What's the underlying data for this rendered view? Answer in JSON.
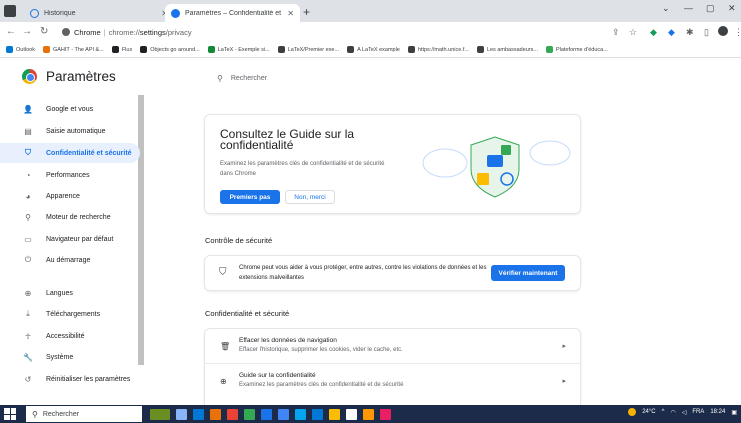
{
  "tabs": [
    {
      "title": "Historique",
      "close": "✕",
      "fav_color": "#1a73e8"
    },
    {
      "title": "Paramètres – Confidentialité et s",
      "close": "✕",
      "fav_color": "#1a73e8"
    }
  ],
  "window_controls": {
    "minimize": "—",
    "restore": "▢",
    "close": "✕",
    "chevron": "⌄"
  },
  "omnibox": {
    "origin": "Chrome",
    "path_prefix": "chrome://",
    "path_bold": "settings",
    "path_rest": "/privacy"
  },
  "bookmarks": [
    {
      "label": "Outlook",
      "color": "#0078d4"
    },
    {
      "label": "GAHIT - The API &...",
      "color": "#e8710a"
    },
    {
      "label": "Flux",
      "color": "#202124"
    },
    {
      "label": "Objects go around...",
      "color": "#202124"
    },
    {
      "label": "LaTeX - Exemple si...",
      "color": "#138a36"
    },
    {
      "label": "LaTeX/Premier exe...",
      "color": "#3c4043"
    },
    {
      "label": "A LaTeX example",
      "color": "#3c4043"
    },
    {
      "label": "https://math.unice.f...",
      "color": "#3c4043"
    },
    {
      "label": "Les ambassadeurs...",
      "color": "#3c4043"
    },
    {
      "label": "Plateforme d'éduca...",
      "color": "#34a853"
    }
  ],
  "settings": {
    "title": "Paramètres",
    "search_placeholder": "Rechercher"
  },
  "sidebar": {
    "items": [
      {
        "label": "Google et vous",
        "icon": "person-icon",
        "glyph": "👤",
        "active": false
      },
      {
        "label": "Saisie automatique",
        "icon": "clipboard-icon",
        "glyph": "▤",
        "active": false
      },
      {
        "label": "Confidentialité et sécurité",
        "icon": "shield-icon",
        "glyph": "⛉",
        "active": true
      },
      {
        "label": "Performances",
        "icon": "gauge-icon",
        "glyph": "◔",
        "active": false
      },
      {
        "label": "Apparence",
        "icon": "palette-icon",
        "glyph": "◕",
        "active": false
      },
      {
        "label": "Moteur de recherche",
        "icon": "search-icon",
        "glyph": "⚲",
        "active": false
      },
      {
        "label": "Navigateur par défaut",
        "icon": "browser-icon",
        "glyph": "▭",
        "active": false
      },
      {
        "label": "Au démarrage",
        "icon": "power-icon",
        "glyph": "⏻",
        "active": false
      },
      {
        "label": "Langues",
        "icon": "globe-icon",
        "glyph": "⊕",
        "active": false
      },
      {
        "label": "Téléchargements",
        "icon": "download-icon",
        "glyph": "⤓",
        "active": false
      },
      {
        "label": "Accessibilité",
        "icon": "accessibility-icon",
        "glyph": "☥",
        "active": false
      },
      {
        "label": "Système",
        "icon": "wrench-icon",
        "glyph": "🔧",
        "active": false
      },
      {
        "label": "Réinitialiser les paramètres",
        "icon": "reset-icon",
        "glyph": "↺",
        "active": false
      }
    ]
  },
  "promo": {
    "title": "Consultez le Guide sur la confidentialité",
    "description": "Examinez les paramètres clés de confidentialité et de sécurité dans Chrome",
    "primary_button": "Premiers pas",
    "secondary_button": "Non, merci"
  },
  "safety_check": {
    "section_title": "Contrôle de sécurité",
    "text": "Chrome peut vous aider à vous protéger, entre autres, contre les violations de données et les extensions malveillantes",
    "button": "Vérifier maintenant"
  },
  "privacy_section": {
    "section_title": "Confidentialité et sécurité",
    "rows": [
      {
        "label": "Effacer les données de navigation",
        "sub": "Effacer l'historique, supprimer les cookies, vider le cache, etc.",
        "icon": "trash-icon",
        "glyph": "🗑"
      },
      {
        "label": "Guide sur la confidentialité",
        "sub": "Examinez les paramètres clés de confidentialité et de sécurité",
        "icon": "compass-icon",
        "glyph": "⊕"
      }
    ]
  },
  "taskbar": {
    "search_label": "Rechercher",
    "weather": "24°C",
    "language": "FRA",
    "time": "18:24"
  },
  "colors": {
    "accent": "#1a73e8",
    "taskbar": "#1c2b4a"
  }
}
